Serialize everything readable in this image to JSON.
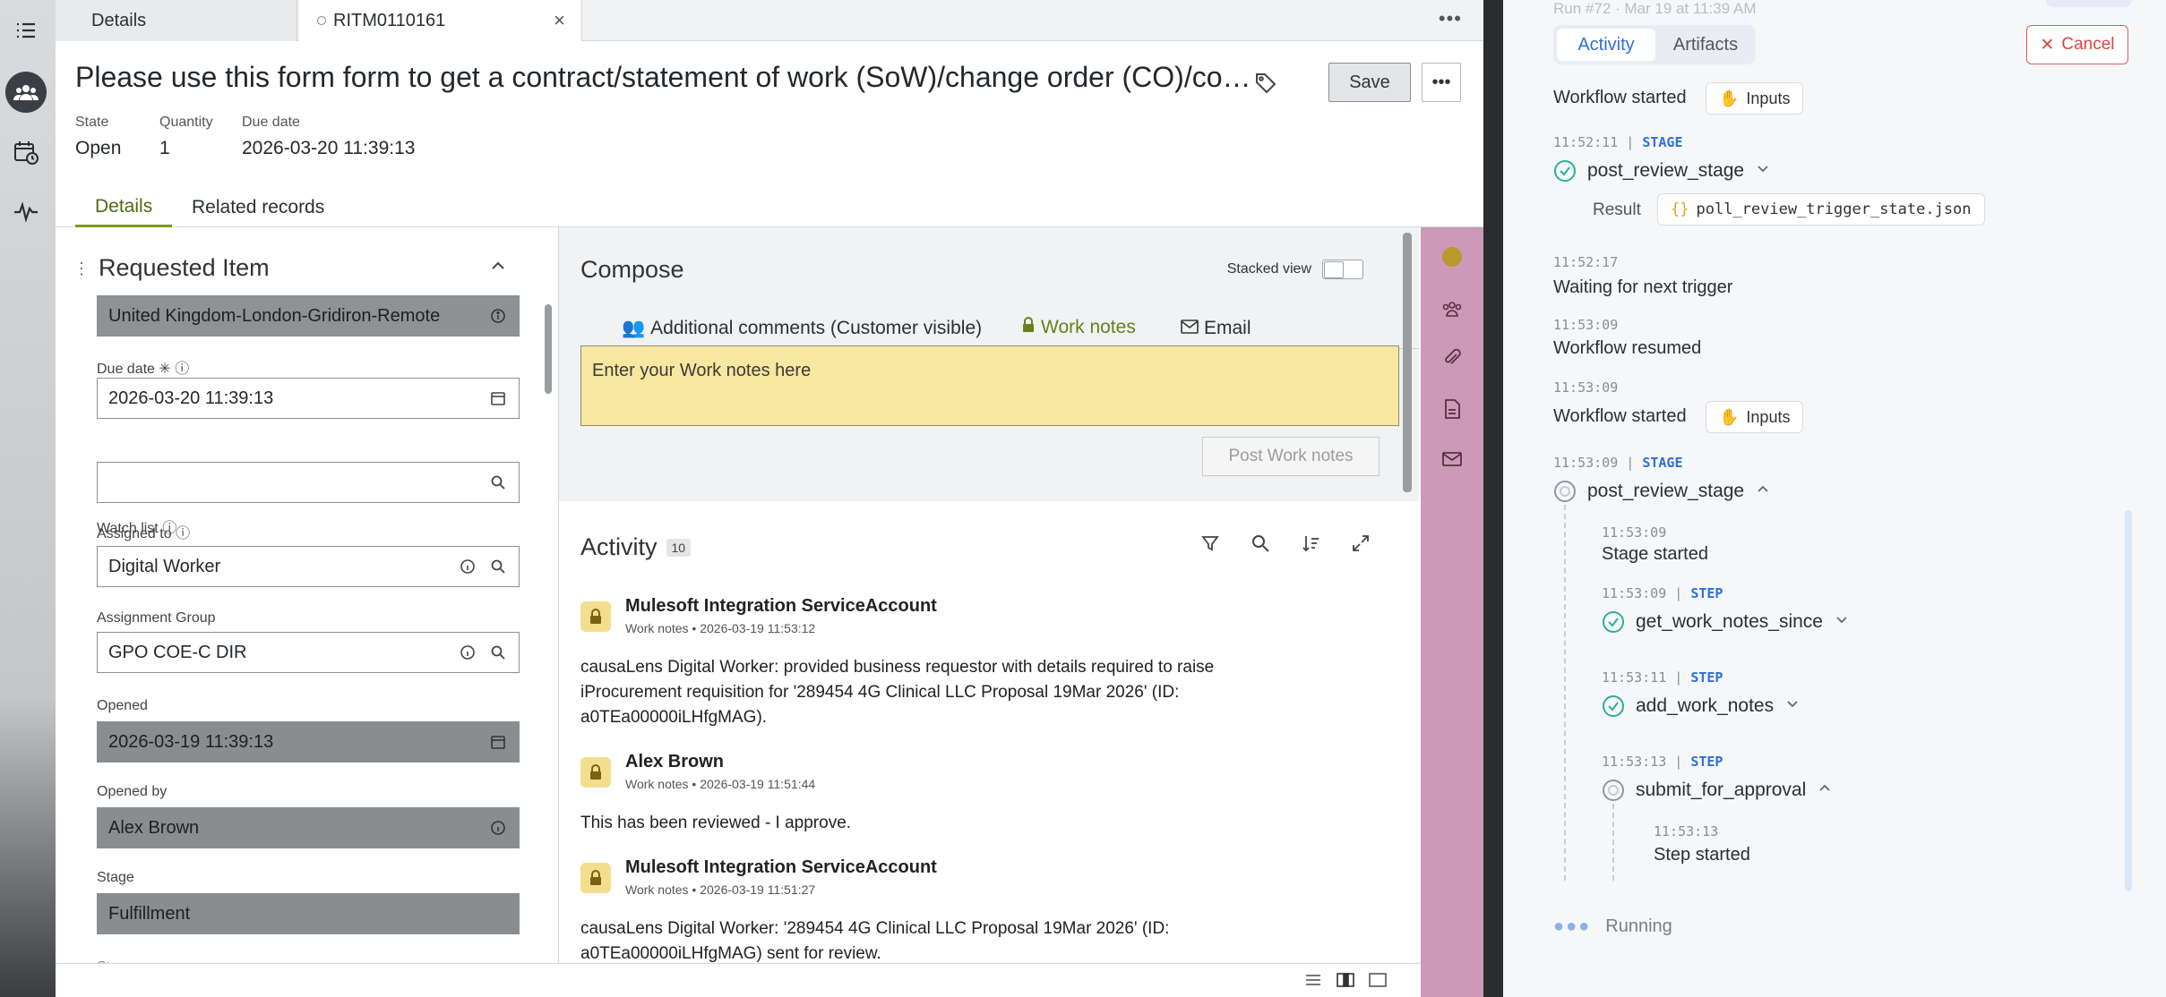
{
  "tabs": {
    "details": "Details",
    "record": "RITM0110161"
  },
  "header": {
    "title": "Please use this form form to get a contract/statement of work (SoW)/change order (CO)/co…",
    "save": "Save",
    "state_label": "State",
    "state_value": "Open",
    "quantity_label": "Quantity",
    "quantity_value": "1",
    "due_label": "Due date",
    "due_value": "2026-03-20 11:39:13"
  },
  "subtabs": {
    "details": "Details",
    "related": "Related records"
  },
  "form": {
    "section": "Requested Item",
    "location": "United Kingdom-London-Gridiron-Remote",
    "due_label": "Due date",
    "due_value": "2026-03-20 11:39:13",
    "watch_label": "Watch list",
    "watch_value": "",
    "assigned_label": "Assigned to",
    "assigned_value": "Digital Worker",
    "group_label": "Assignment Group",
    "group_value": "GPO COE-C DIR",
    "opened_label": "Opened",
    "opened_value": "2026-03-19 11:39:13",
    "openedby_label": "Opened by",
    "openedby_value": "Alex Brown",
    "stage_label": "Stage",
    "stage_value": "Fulfillment",
    "next_label": "St..."
  },
  "compose": {
    "title": "Compose",
    "stacked": "Stacked view",
    "tab_comments": "Additional comments (Customer visible)",
    "tab_work": "Work notes",
    "tab_email": "Email",
    "placeholder": "Enter your Work notes here",
    "post": "Post Work notes"
  },
  "activity": {
    "title": "Activity",
    "count": "10",
    "entries": [
      {
        "who": "Mulesoft Integration ServiceAccount",
        "sub": "Work notes • 2026-03-19 11:53:12",
        "l1": "causaLens Digital Worker: provided business requestor with details required to raise",
        "l2": "iProcurement requisition for '289454 4G Clinical LLC Proposal 19Mar 2026' (ID:",
        "l3": "a0TEa00000iLHfgMAG)."
      },
      {
        "who": "Alex Brown",
        "sub": "Work notes • 2026-03-19 11:51:44",
        "l1": "This has been reviewed - I approve."
      },
      {
        "who": "Mulesoft Integration ServiceAccount",
        "sub": "Work notes • 2026-03-19 11:51:27",
        "l1": "causaLens Digital Worker: '289454 4G Clinical LLC Proposal 19Mar 2026' (ID:",
        "l2": "a0TEa00000iLHfgMAG) sent for review."
      }
    ]
  },
  "workflow": {
    "run": "Run #72 · Mar 19 at 11:39 AM",
    "tab_activity": "Activity",
    "tab_artifacts": "Artifacts",
    "cancel": "Cancel",
    "ev0": "Workflow started",
    "inputs": "Inputs",
    "t1": "11:52:11",
    "stage_kw": "STAGE",
    "step_kw": "STEP",
    "stage1": "post_review_stage",
    "result_label": "Result",
    "result_file": "poll_review_trigger_state.json",
    "t2": "11:52:17",
    "ev2": "Waiting for next trigger",
    "t3": "11:53:09",
    "ev3": "Workflow resumed",
    "t4": "11:53:09",
    "ev4": "Workflow started",
    "t5": "11:53:09",
    "stage2": "post_review_stage",
    "t6": "11:53:09",
    "ev6": "Stage started",
    "t7": "11:53:09",
    "step1": "get_work_notes_since",
    "t8": "11:53:11",
    "step2": "add_work_notes",
    "t9": "11:53:13",
    "step3": "submit_for_approval",
    "t10": "11:53:13",
    "ev10": "Step started",
    "running": "Running"
  }
}
